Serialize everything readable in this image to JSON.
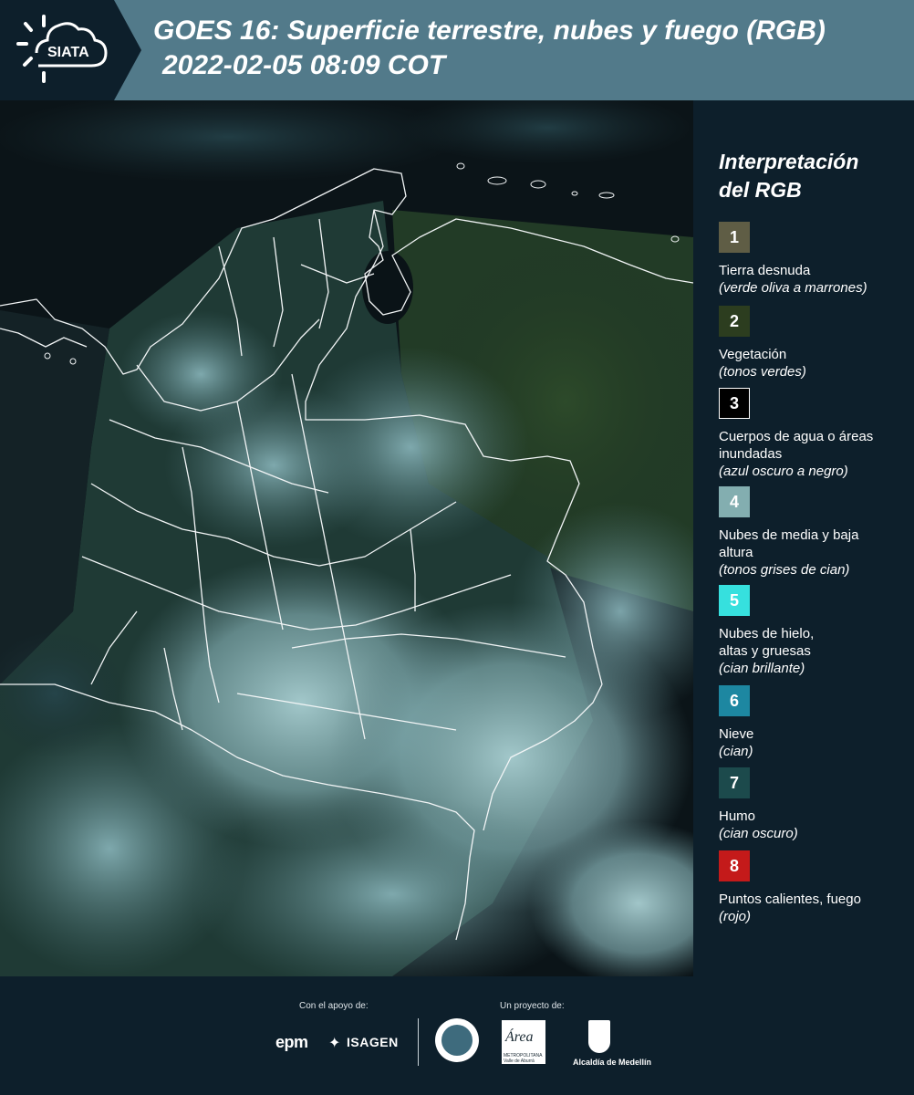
{
  "header": {
    "logo_text": "SIATA",
    "title": "GOES 16: Superficie terrestre, nubes y fuego (RGB)",
    "subtitle": "2022-02-05 08:09 COT"
  },
  "legend": {
    "title_line1": "Interpretación",
    "title_line2": "del RGB",
    "items": [
      {
        "number": "1",
        "color": "#5f5d45",
        "label": "Tierra desnuda",
        "note": "(verde oliva a marrones)"
      },
      {
        "number": "2",
        "color": "#2c3d1f",
        "label": "Vegetación",
        "note": "(tonos verdes)"
      },
      {
        "number": "3",
        "color": "#000000",
        "label": "Cuerpos de agua o áreas inundadas",
        "note": "(azul oscuro a negro)"
      },
      {
        "number": "4",
        "color": "#83aeb0",
        "label": "Nubes de media y baja altura",
        "note": "(tonos grises de cian)"
      },
      {
        "number": "5",
        "color": "#36e0de",
        "label": "Nubes de hielo, altas y gruesas",
        "note": "(cian brillante)"
      },
      {
        "number": "6",
        "color": "#1d87a1",
        "label": "Nieve",
        "note": "(cian)"
      },
      {
        "number": "7",
        "color": "#1c4a4c",
        "label": "Humo",
        "note": "(cian oscuro)"
      },
      {
        "number": "8",
        "color": "#c41a1a",
        "label": "Puntos calientes, fuego",
        "note": "(rojo)"
      }
    ]
  },
  "footer": {
    "support_caption": "Con el apoyo de:",
    "project_caption": "Un proyecto de:",
    "sponsors": [
      "epm",
      "ISAGEN"
    ],
    "partners": [
      "Área Metropolitana",
      "Alcaldía de Medellín"
    ],
    "area_logo_text": "Área",
    "area_logo_subtext": "METROPOLITANA Valle de Aburrá",
    "alcaldia_label": "Alcaldía de Medellín"
  }
}
